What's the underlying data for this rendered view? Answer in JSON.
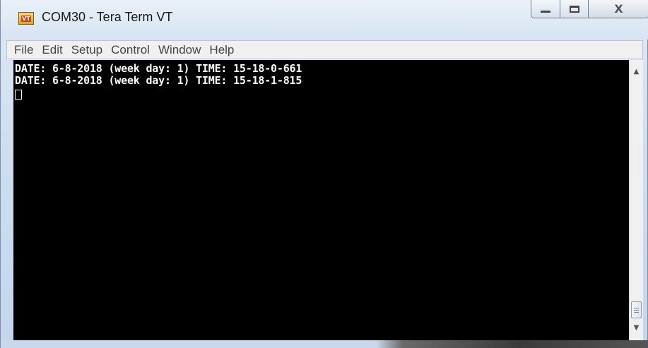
{
  "window": {
    "title": "COM30 - Tera Term VT",
    "icon_text": "VT"
  },
  "menu": {
    "items": [
      "File",
      "Edit",
      "Setup",
      "Control",
      "Window",
      "Help"
    ]
  },
  "terminal": {
    "lines": [
      "DATE: 6-8-2018 (week day: 1) TIME: 15-18-0-661",
      "DATE: 6-8-2018 (week day: 1) TIME: 15-18-1-815"
    ],
    "background": "#000000",
    "foreground": "#ffffff"
  },
  "scrollbar": {
    "up_icon": "▲",
    "down_icon": "▼"
  },
  "caption_buttons": {
    "close_glyph": "X"
  }
}
